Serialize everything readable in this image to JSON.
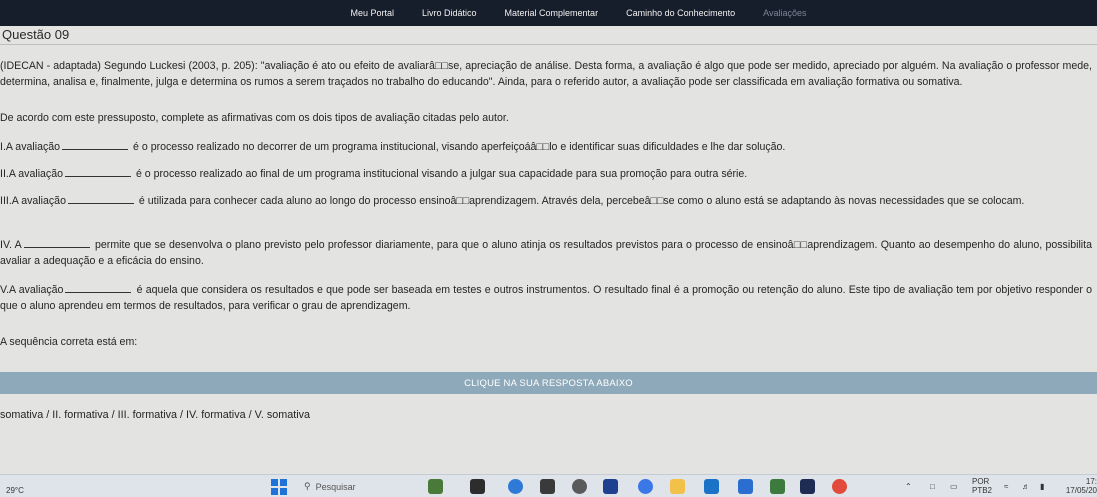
{
  "nav": {
    "items": [
      "Meu Portal",
      "Livro Didático",
      "Material Complementar",
      "Caminho do Conhecimento",
      "Avaliações"
    ]
  },
  "question": {
    "title": "Questão 09",
    "intro_1": "(IDECAN - adaptada) Segundo Luckesi (2003, p. 205): \"avaliação é ato ou efeito de avaliarâ□□se, apreciação de análise. Desta forma, a avaliação é algo que pode ser medido, apreciado por alguém. Na avaliação o professor mede, determina, analisa e, finalmente, julga e determina os rumos a serem traçados no trabalho do educando\". Ainda, para o referido autor, a avaliação pode ser classificada em avaliação formativa ou somativa.",
    "intro_2": "De acordo com este pressuposto, complete as afirmativas com os dois tipos de avaliação citadas pelo autor.",
    "s1_a": "I.A avaliação",
    "s1_b": "é o processo realizado no decorrer de um programa institucional, visando aperfeiçoáâ□□lo e identificar suas dificuldades e lhe dar solução.",
    "s2_a": "II.A avaliação",
    "s2_b": "é o processo realizado ao final de um programa institucional visando a julgar sua capacidade para sua promoção para outra série.",
    "s3_a": "III.A avaliação",
    "s3_b": "é utilizada para conhecer cada aluno ao longo do processo ensinoâ□□aprendizagem. Através dela, percebeâ□□se como o aluno está se adaptando às novas necessidades que se colocam.",
    "s4_a": "IV. A",
    "s4_b": "permite que se desenvolva o plano previsto pelo professor diariamente, para que o aluno atinja os resultados previstos para o processo de ensinoâ□□aprendizagem. Quanto ao desempenho do aluno, possibilita avaliar a adequação e a eficácia do ensino.",
    "s5_a": "V.A avaliação",
    "s5_b": "é aquela que considera os resultados e que pode ser baseada em testes e outros instrumentos. O resultado final é a promoção ou retenção do aluno. Este tipo de avaliação tem por objetivo responder o que o aluno aprendeu em termos de resultados, para verificar o grau de aprendizagem.",
    "prompt": "A sequência correta está em:",
    "answer_bar": "CLIQUE NA SUA RESPOSTA ABAIXO",
    "option": "somativa / II. formativa / III. formativa / IV. formativa / V. somativa"
  },
  "taskbar": {
    "temperature": "29°C",
    "search_placeholder": "Pesquisar",
    "lang_1": "POR",
    "lang_2": "PTB2",
    "time": "17:",
    "date": "17/05/20"
  },
  "colors": {
    "nav_bg": "#161d2b",
    "answer_bar": "#8ea9b9",
    "page_bg": "#e3e3e1"
  }
}
